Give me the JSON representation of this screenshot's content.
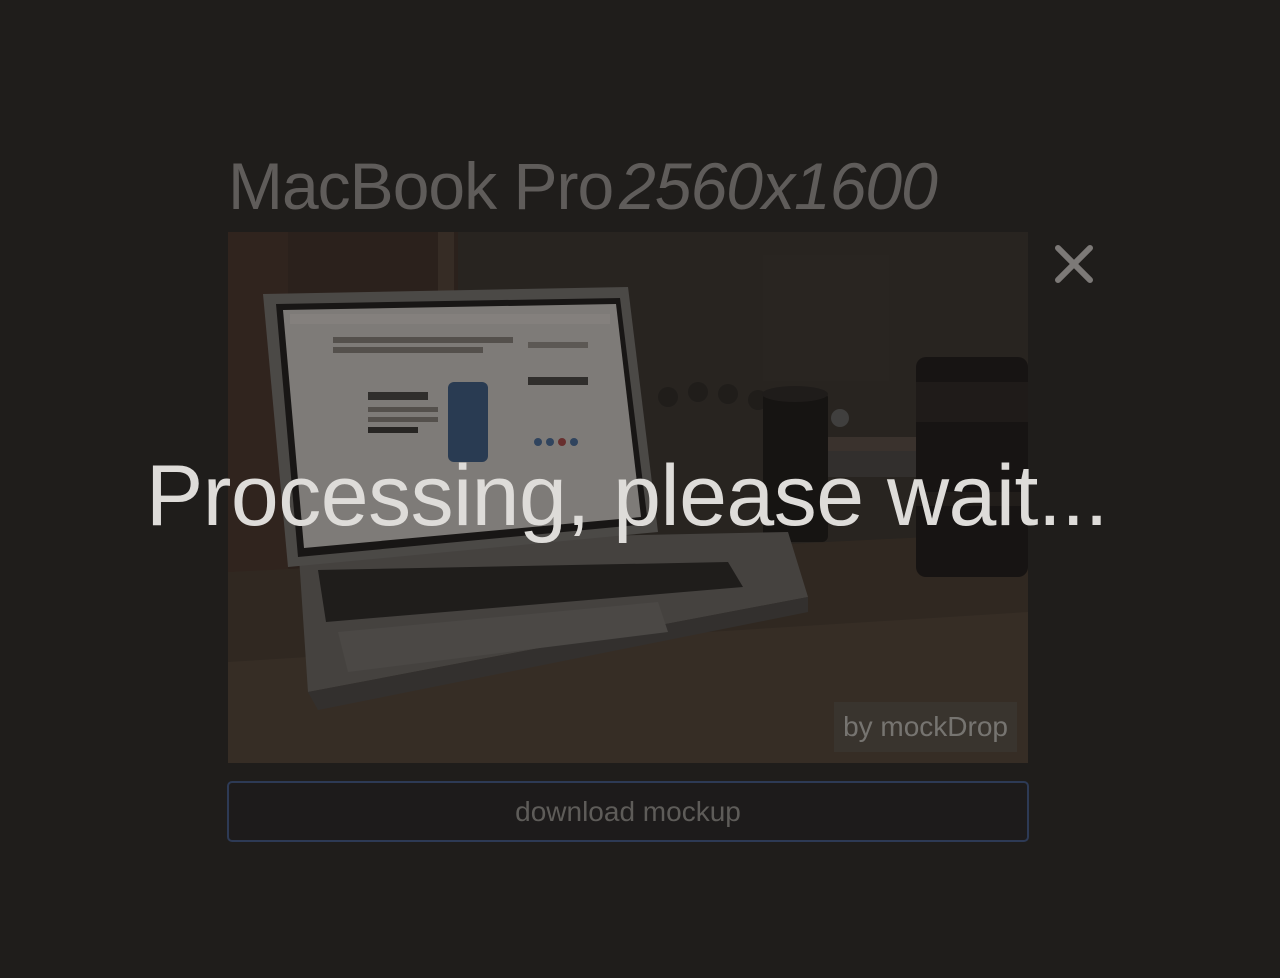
{
  "header": {
    "device_name": "MacBook Pro",
    "resolution": "2560x1600"
  },
  "close_icon": "close-icon",
  "preview": {
    "credit_label": "by mockDrop"
  },
  "actions": {
    "download_label": "download mockup"
  },
  "overlay": {
    "message": "Processing, please wait..."
  },
  "colors": {
    "background": "#1f1d1b",
    "title_text": "#5f5c5a",
    "button_border": "#2d3a55",
    "overlay_text": "#dedcd9"
  }
}
